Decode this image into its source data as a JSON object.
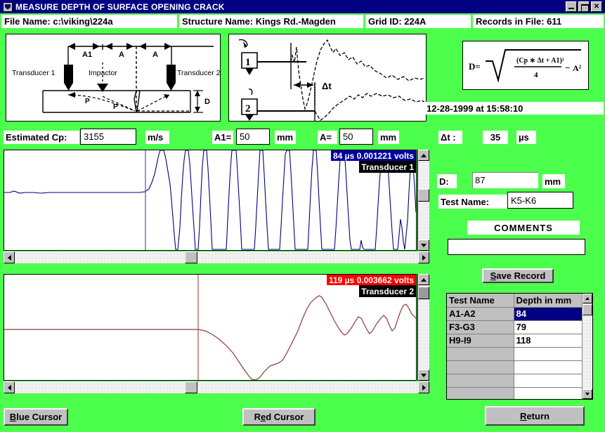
{
  "window": {
    "title": "MEASURE DEPTH OF SURFACE OPENING CRACK",
    "icon": "app-icon",
    "minimize_label": "_",
    "maximize_label": "□",
    "close_label": "✕"
  },
  "info_bar": {
    "file_name": "File Name: c:\\viking\\224a",
    "structure_name": "Structure Name: Kings Rd.-Magden",
    "grid_id": "Grid ID: 224A",
    "records_in_file": "Records in File:  611"
  },
  "diagram_setup": {
    "name": "transducer-setup-diagram",
    "transducer_1": "Transducer 1",
    "transducer_2": "Transducer 2",
    "impactor": "Impactor",
    "dim_a1": "A1",
    "dim_a_left": "A",
    "dim_a_right": "A",
    "path_p_1": "P",
    "path_p_2": "P",
    "depth_d": "D"
  },
  "diagram_wave": {
    "name": "waveform-timing-diagram",
    "channel_1": "1",
    "channel_2": "2",
    "delta_t": "Δt"
  },
  "formula": {
    "name": "depth-formula",
    "lhs": "D=",
    "numerator": "(Cp ∗ Δt + A1)²",
    "denominator": "4",
    "minus_term": "A²"
  },
  "timestamp": "12-28-1999 at 15:58:10",
  "inputs": {
    "cp_label": "Estimated Cp:",
    "cp_value": "3155",
    "cp_units": "m/s",
    "a1_label": "A1=",
    "a1_value": "50",
    "a1_units": "mm",
    "a_label": "A=",
    "a_value": "50",
    "a_units": "mm"
  },
  "results": {
    "delta_t_label": "Δt :",
    "delta_t_value": "35",
    "delta_t_units": "µs",
    "depth_label": "D:",
    "depth_value": "87",
    "depth_units": "mm",
    "test_name_label": "Test Name:",
    "test_name_value": "K5-K6"
  },
  "comments": {
    "title": "COMMENTS",
    "value": "",
    "placeholder": ""
  },
  "save_button": "Save Record",
  "chart_data": [
    {
      "type": "line",
      "name": "transducer-1-waveform",
      "title": "Transducer 1",
      "cursor_readout": "84 µs 0.001221 volts",
      "cursor_time_us": 84,
      "cursor_voltage": 0.001221,
      "cursor_color": "#0000a0",
      "trace_color": "#000080",
      "xlabel": "",
      "ylabel": "volts",
      "grid": false,
      "legend": "Transducer 1",
      "x": [
        0,
        6,
        12,
        18,
        24,
        30,
        36,
        42,
        48,
        54,
        60,
        66,
        72,
        78,
        84,
        87,
        90,
        93,
        96,
        99,
        104,
        110,
        116,
        122,
        128,
        134,
        140,
        146,
        152,
        158,
        164,
        170,
        176,
        182,
        188,
        194,
        200,
        206,
        212,
        218,
        224,
        230,
        236,
        242,
        248,
        254,
        260,
        266,
        272,
        278,
        284
      ],
      "y": [
        0.0,
        0.01,
        -0.01,
        0.0,
        0.01,
        0.0,
        0.0,
        0.0,
        0.0,
        0.0,
        0.0,
        0.0,
        0.0,
        0.0,
        0.0,
        0.12,
        0.3,
        0.62,
        1.0,
        0.82,
        0.7,
        -1.0,
        -1.0,
        0.95,
        0.95,
        -1.0,
        -1.0,
        0.92,
        0.92,
        -0.98,
        -1.0,
        -0.35,
        -0.95,
        0.9,
        0.9,
        -0.35,
        0.88,
        0.88,
        -1.0,
        -1.0,
        -0.9,
        -0.45,
        -1.0,
        -0.55,
        0.05,
        0.62,
        0.8,
        0.55,
        -0.55,
        0.1,
        0.1
      ]
    },
    {
      "type": "line",
      "name": "transducer-2-waveform",
      "title": "Transducer 2",
      "cursor_readout": "119 µs 0.003662 volts",
      "cursor_time_us": 119,
      "cursor_voltage": 0.003662,
      "cursor_color": "#ff0000",
      "trace_color": "#8b3a3a",
      "xlabel": "",
      "ylabel": "volts",
      "grid": false,
      "legend": "Transducer 2",
      "x": [
        0,
        10,
        20,
        30,
        40,
        50,
        60,
        70,
        80,
        90,
        100,
        110,
        119,
        126,
        134,
        142,
        150,
        158,
        166,
        174,
        182,
        190,
        198,
        206,
        214,
        222,
        230,
        238,
        246,
        254,
        262,
        270,
        278,
        286,
        294
      ],
      "y": [
        0.0,
        0.0,
        0.0,
        0.0,
        0.0,
        0.0,
        0.0,
        0.0,
        0.0,
        0.0,
        0.0,
        0.0,
        0.0,
        -0.1,
        -0.34,
        -0.62,
        -0.9,
        -1.0,
        -0.92,
        -0.62,
        -0.4,
        -0.38,
        -0.1,
        0.45,
        0.78,
        0.86,
        0.52,
        0.1,
        0.02,
        0.42,
        0.08,
        0.38,
        0.05,
        0.58,
        0.22
      ]
    }
  ],
  "scrollbars": {
    "blue_h_position": 0.43,
    "blue_v_position": 0.45,
    "red_h_position": 0.43,
    "red_v_position": 0.12,
    "grid_v_position": 0.05,
    "up_arrow": "▲",
    "down_arrow": "▼",
    "left_arrow": "◄",
    "right_arrow": "►"
  },
  "records_table": {
    "columns": [
      "Test Name",
      "Depth in mm"
    ],
    "rows": [
      {
        "test_name": "A1-A2",
        "depth": "84",
        "selected": true
      },
      {
        "test_name": "F3-G3",
        "depth": "79",
        "selected": false
      },
      {
        "test_name": "H9-I9",
        "depth": "118",
        "selected": false
      },
      {
        "test_name": "",
        "depth": "",
        "selected": false
      },
      {
        "test_name": "",
        "depth": "",
        "selected": false
      },
      {
        "test_name": "",
        "depth": "",
        "selected": false
      },
      {
        "test_name": "",
        "depth": "",
        "selected": false
      }
    ]
  },
  "footer": {
    "blue_cursor": "Blue Cursor",
    "blue_cursor_accel": "B",
    "blue_cursor_rest": "lue Cursor",
    "red_cursor_pre": "R",
    "red_cursor_accel": "e",
    "red_cursor_rest": "d Cursor",
    "return_accel": "R",
    "return_rest": "eturn"
  },
  "colors": {
    "background": "#4dff4d",
    "titlebar": "#000080",
    "blue_tag": "#0000a0",
    "red_tag": "#ff0000",
    "selection": "#000080",
    "chrome": "#c0c0c0"
  }
}
